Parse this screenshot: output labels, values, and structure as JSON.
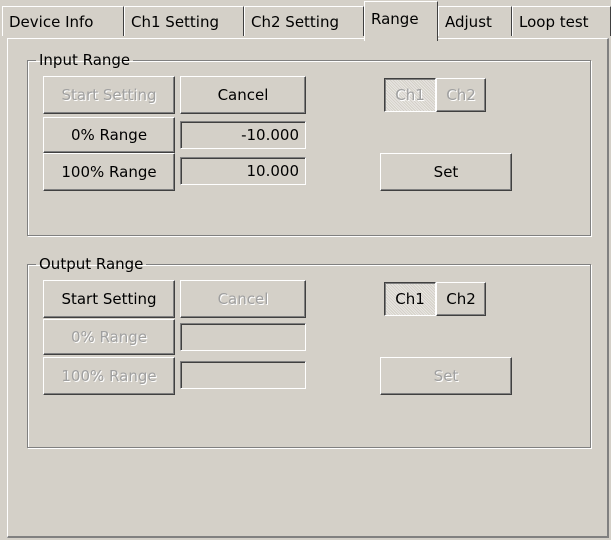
{
  "tabs": [
    {
      "label": "Device Info",
      "active": false
    },
    {
      "label": "Ch1 Setting",
      "active": false
    },
    {
      "label": "Ch2 Setting",
      "active": false
    },
    {
      "label": "Range",
      "active": true
    },
    {
      "label": "Adjust",
      "active": false
    },
    {
      "label": "Loop test",
      "active": false
    }
  ],
  "input_range": {
    "legend": "Input Range",
    "start_setting": "Start Setting",
    "cancel": "Cancel",
    "zero_range": "0% Range",
    "zero_value": "-10.000",
    "hundred_range": "100% Range",
    "hundred_value": "10.000",
    "ch1": "Ch1",
    "ch2": "Ch2",
    "set": "Set"
  },
  "output_range": {
    "legend": "Output Range",
    "start_setting": "Start Setting",
    "cancel": "Cancel",
    "zero_range": "0% Range",
    "zero_value": "",
    "hundred_range": "100% Range",
    "hundred_value": "",
    "ch1": "Ch1",
    "ch2": "Ch2",
    "set": "Set"
  }
}
